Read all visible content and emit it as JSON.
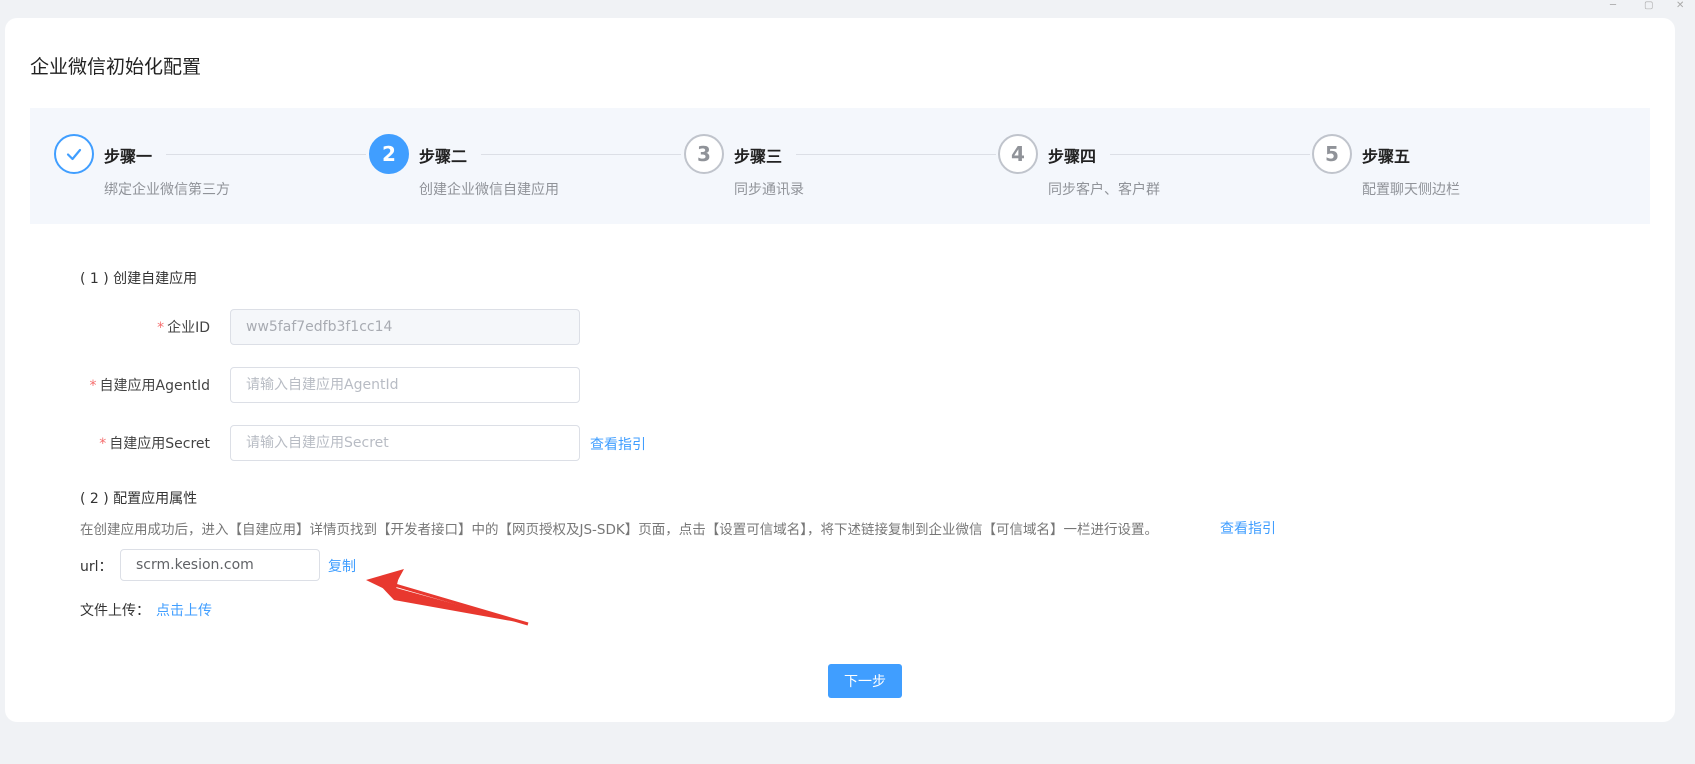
{
  "page": {
    "title": "企业微信初始化配置"
  },
  "steps": [
    {
      "index": "1",
      "title": "步骤一",
      "desc": "绑定企业微信第三方",
      "state": "done",
      "icon": "check-icon"
    },
    {
      "index": "2",
      "title": "步骤二",
      "desc": "创建企业微信自建应用",
      "state": "active"
    },
    {
      "index": "3",
      "title": "步骤三",
      "desc": "同步通讯录",
      "state": "wait"
    },
    {
      "index": "4",
      "title": "步骤四",
      "desc": "同步客户、客户群",
      "state": "wait"
    },
    {
      "index": "5",
      "title": "步骤五",
      "desc": "配置聊天侧边栏",
      "state": "wait"
    }
  ],
  "section1": {
    "title": "( 1 ) 创建自建应用"
  },
  "form": {
    "required_mark": "*",
    "corp_id": {
      "label": "企业ID",
      "value": "ww5faf7edfb3f1cc14"
    },
    "agent_id": {
      "label": "自建应用AgentId",
      "value": "",
      "placeholder": "请输入自建应用AgentId"
    },
    "secret": {
      "label": "自建应用Secret",
      "value": "",
      "placeholder": "请输入自建应用Secret"
    },
    "guide_link": "查看指引"
  },
  "section2": {
    "title": "( 2 ) 配置应用属性",
    "description": "在创建应用成功后，进入【自建应用】详情页找到【开发者接口】中的【网页授权及JS-SDK】页面，点击【设置可信域名】，将下述链接复制到企业微信【可信域名】一栏进行设置。",
    "guide_link": "查看指引",
    "url_label": "url：",
    "url_value": "scrm.kesion.com",
    "copy_link": "复制",
    "upload_label": "文件上传：",
    "upload_link": "点击上传"
  },
  "actions": {
    "next_label": "下一步"
  },
  "colors": {
    "primary": "#409eff",
    "required": "#f56c6c",
    "annotation_arrow": "#e8382f"
  }
}
